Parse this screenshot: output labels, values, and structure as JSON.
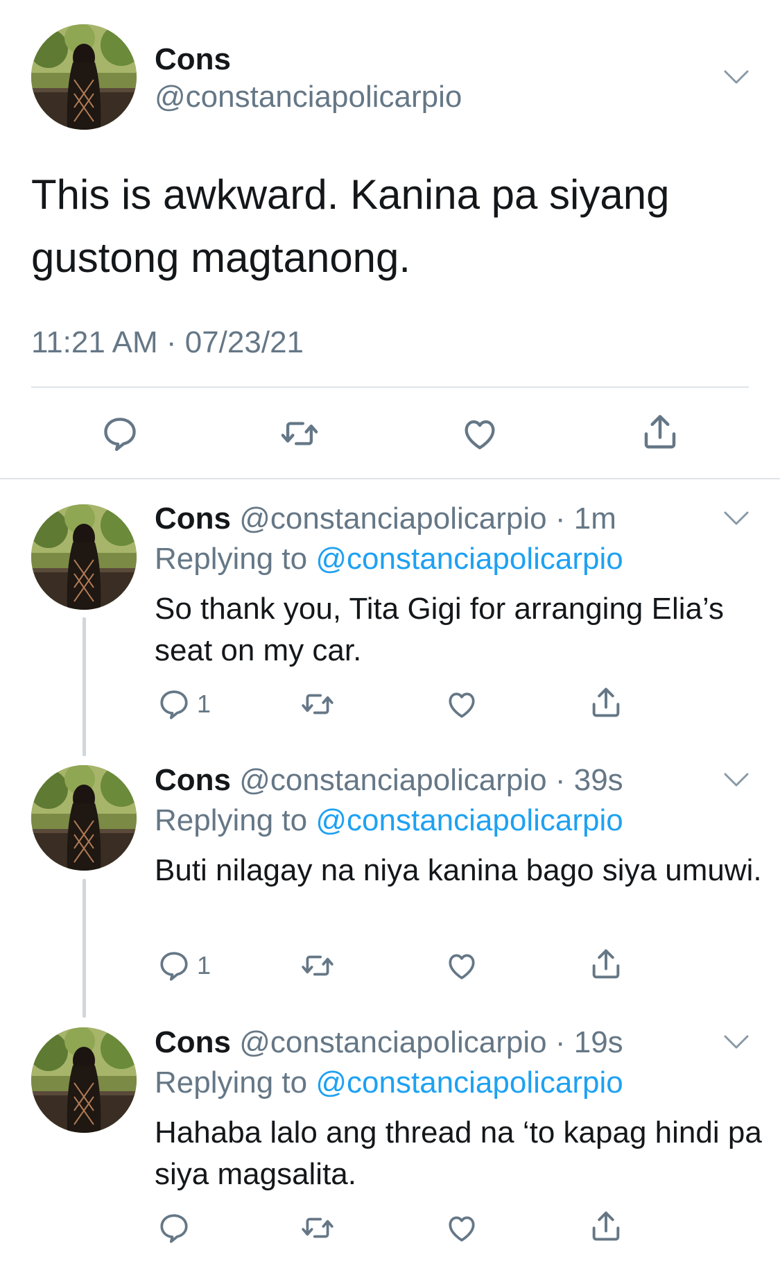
{
  "main_tweet": {
    "name": "Cons",
    "handle": "@constanciapolicarpio",
    "text": "This is awkward. Kanina pa siyang gustong magtanong.",
    "timestamp": "11:21 AM · 07/23/21",
    "avatar_icon": "profile-photo",
    "actions": [
      "reply-icon",
      "retweet-icon",
      "like-icon",
      "share-icon"
    ]
  },
  "replies": [
    {
      "name": "Cons",
      "handle": "@constanciapolicarpio",
      "separator": "·",
      "time": "1m",
      "replying_label": "Replying to",
      "replying_to": "@constanciapolicarpio",
      "text": "So thank you, Tita Gigi for arranging Elia’s seat on my car.",
      "reply_count": "1"
    },
    {
      "name": "Cons",
      "handle": "@constanciapolicarpio",
      "separator": "·",
      "time": "39s",
      "replying_label": "Replying to",
      "replying_to": "@constanciapolicarpio",
      "text": "Buti nilagay na niya kanina bago siya umuwi.",
      "reply_count": "1"
    },
    {
      "name": "Cons",
      "handle": "@constanciapolicarpio",
      "separator": "·",
      "time": "19s",
      "replying_label": "Replying to",
      "replying_to": "@constanciapolicarpio",
      "text": "Hahaba lalo ang thread na ‘to kapag hindi pa siya magsalita.",
      "reply_count": ""
    }
  ],
  "colors": {
    "primary_text": "#14171a",
    "secondary_text": "#657786",
    "mention": "#1da1f2",
    "divider": "#dfe3e6",
    "thread_line": "#cfd6dc"
  }
}
